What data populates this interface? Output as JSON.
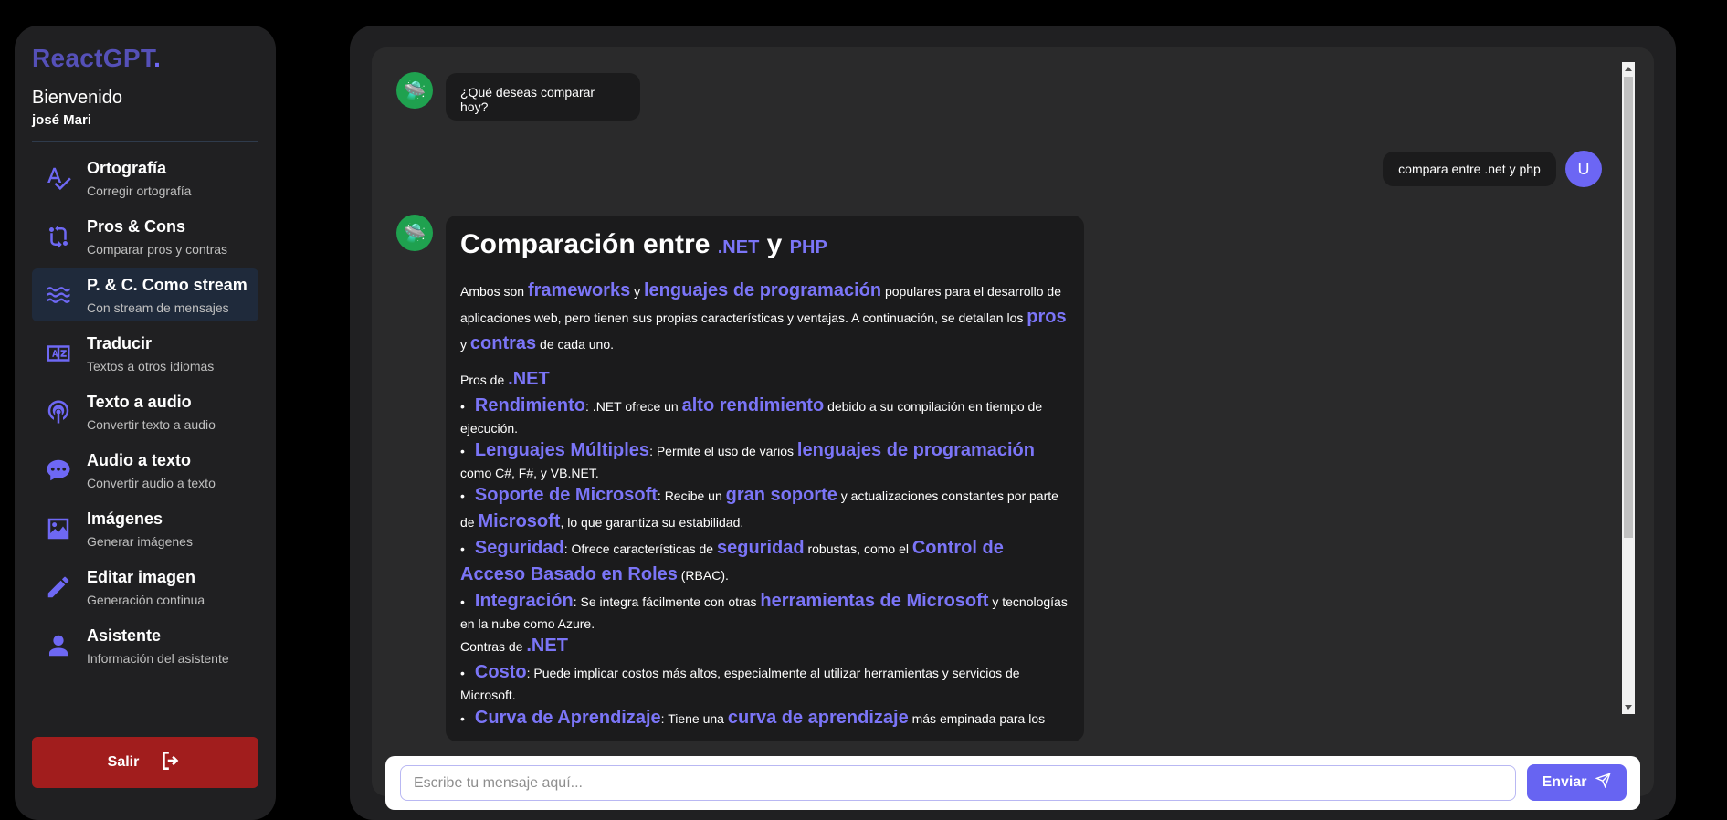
{
  "app": {
    "logo_text": "ReactGPT",
    "logo_dot": ".",
    "welcome": "Bienvenido",
    "user_name": "josé Mari"
  },
  "sidebar": {
    "items": [
      {
        "title": "Ortografía",
        "subtitle": "Corregir ortografía",
        "icon": "spellcheck-icon"
      },
      {
        "title": "Pros & Cons",
        "subtitle": "Comparar pros y contras",
        "icon": "compare-arrows-icon"
      },
      {
        "title": "P. & C. Como stream",
        "subtitle": "Con stream de mensajes",
        "icon": "waves-icon"
      },
      {
        "title": "Traducir",
        "subtitle": "Textos a otros idiomas",
        "icon": "translate-icon"
      },
      {
        "title": "Texto a audio",
        "subtitle": "Convertir texto a audio",
        "icon": "podcast-icon"
      },
      {
        "title": "Audio a texto",
        "subtitle": "Convertir audio a texto",
        "icon": "chat-bubble-icon"
      },
      {
        "title": "Imágenes",
        "subtitle": "Generar imágenes",
        "icon": "image-icon"
      },
      {
        "title": "Editar imagen",
        "subtitle": "Generación continua",
        "icon": "pencil-icon"
      },
      {
        "title": "Asistente",
        "subtitle": "Información del asistente",
        "icon": "user-icon"
      }
    ],
    "active_index": 2,
    "logout_label": "Salir"
  },
  "chat": {
    "bot_greeting": "¿Qué deseas comparar hoy?",
    "user_message": "compara entre .net y php",
    "user_avatar_letter": "U",
    "response": {
      "title_prefix": "Comparación entre ",
      "title_a": ".NET",
      "title_mid": " y ",
      "title_b": "PHP",
      "intro": {
        "t1": "Ambos son ",
        "h1": "frameworks",
        "t2": " y ",
        "h2": "lenguajes de programación",
        "t3": " populares para el desarrollo de aplicaciones web, pero tienen sus propias características y ventajas. A continuación, se detallan los ",
        "h3": "pros",
        "t4": " y ",
        "h4": "contras",
        "t5": " de cada uno."
      },
      "pros_heading_text": "Pros de ",
      "pros_heading_hl": ".NET",
      "pros": [
        {
          "h": "Rendimiento",
          "t1": ": .NET ofrece un ",
          "h2": "alto rendimiento",
          "t2": " debido a su compilación en tiempo de ejecución."
        },
        {
          "h": "Lenguajes Múltiples",
          "t1": ": Permite el uso de varios ",
          "h2": "lenguajes de programación",
          "t2": " como C#, F#, y VB.NET."
        },
        {
          "h": "Soporte de Microsoft",
          "t1": ": Recibe un ",
          "h2": "gran soporte",
          "t2": " y actualizaciones constantes por parte de ",
          "h3": "Microsoft",
          "t3": ", lo que garantiza su estabilidad."
        },
        {
          "h": "Seguridad",
          "t1": ": Ofrece características de ",
          "h2": "seguridad",
          "t2": " robustas, como el ",
          "h3": "Control de Acceso Basado en Roles",
          "t3": " (RBAC)."
        },
        {
          "h": "Integración",
          "t1": ": Se integra fácilmente con otras ",
          "h2": "herramientas de Microsoft",
          "t2": " y tecnologías en la nube como Azure."
        }
      ],
      "cons_heading_text": "Contras de ",
      "cons_heading_hl": ".NET",
      "cons": [
        {
          "h": "Costo",
          "t1": ": Puede implicar costos más altos, especialmente al utilizar herramientas y servicios de Microsoft."
        },
        {
          "h": "Curva de Aprendizaje",
          "t1": ": Tiene una ",
          "h2": "curva de aprendizaje",
          "t2": " más empinada para los"
        }
      ]
    }
  },
  "input": {
    "placeholder": "Escribe tu mensaje aquí...",
    "send_label": "Enviar"
  }
}
